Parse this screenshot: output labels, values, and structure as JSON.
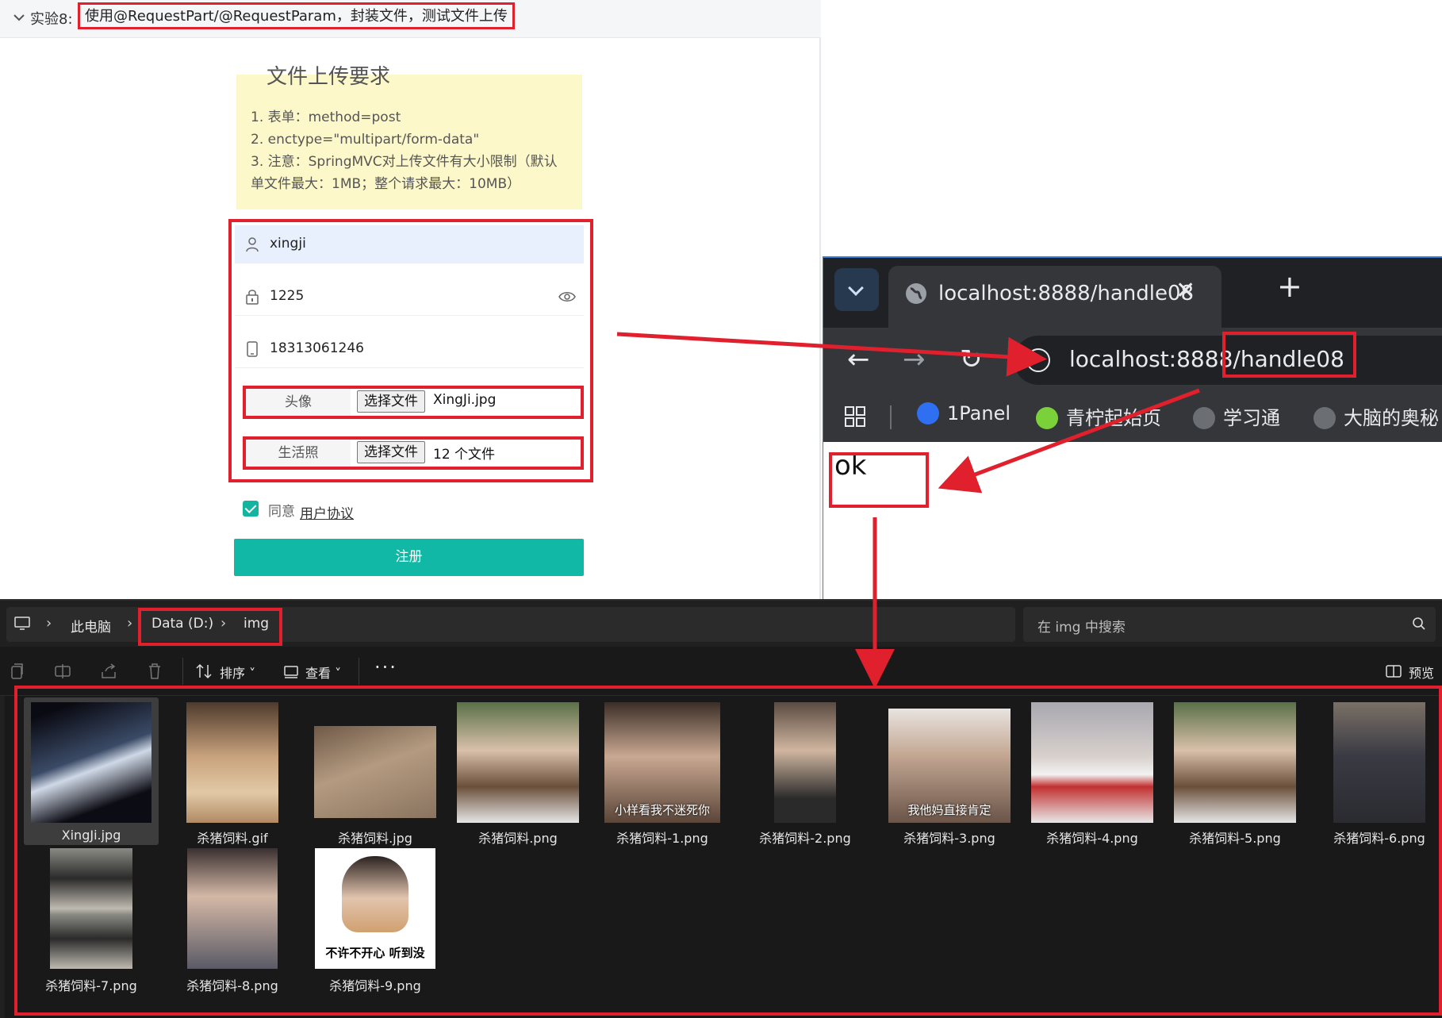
{
  "form": {
    "experiment_label": "实验8:",
    "experiment_title": "使用@RequestPart/@RequestParam，封装文件，测试文件上传",
    "requirements_title": "文件上传要求",
    "requirements": [
      "1. 表单：method=post",
      "2. enctype=\"multipart/form-data\"",
      "3. 注意：SpringMVC对上传文件有大小限制（默认单文件最大：1MB；整个请求最大：10MB）"
    ],
    "username": "xingji",
    "password": "1225",
    "phone": "18313061246",
    "avatar_label": "头像",
    "avatar_button": "选择文件",
    "avatar_file": "XingJi.jpg",
    "photos_label": "生活照",
    "photos_button": "选择文件",
    "photos_file": "12 个文件",
    "agree_text": "同意",
    "agree_link": "用户协议",
    "register_label": "注册"
  },
  "browser": {
    "tab_title": "localhost:8888/handle08",
    "close_glyph": "✕",
    "new_tab_glyph": "+",
    "back_glyph": "←",
    "forward_glyph": "→",
    "reload_glyph": "↻",
    "url_host": "localhost:8888",
    "url_path": "/handle08",
    "bookmarks": [
      "1Panel",
      "青柠起始页",
      "学习通",
      "大脑的奥秘"
    ],
    "page_text": "ok"
  },
  "explorer": {
    "crumb_sep": "›",
    "crumbs": [
      "此电脑",
      "Data (D:)",
      "img"
    ],
    "search_placeholder": "在 img 中搜索",
    "sort_label": "排序",
    "view_label": "查看",
    "more_glyph": "···",
    "preview_label": "预览",
    "files": [
      {
        "name": "XingJi.jpg",
        "overlay": ""
      },
      {
        "name": "杀猪饲料.gif",
        "overlay": ""
      },
      {
        "name": "杀猪饲料.jpg",
        "overlay": ""
      },
      {
        "name": "杀猪饲料.png",
        "overlay": ""
      },
      {
        "name": "杀猪饲料-1.png",
        "overlay": "小样看我不迷死你"
      },
      {
        "name": "杀猪饲料-2.png",
        "overlay": ""
      },
      {
        "name": "杀猪饲料-3.png",
        "overlay": "我他妈直接肯定"
      },
      {
        "name": "杀猪饲料-4.png",
        "overlay": ""
      },
      {
        "name": "杀猪饲料-5.png",
        "overlay": ""
      },
      {
        "name": "杀猪饲料-6.png",
        "overlay": ""
      },
      {
        "name": "杀猪饲料-7.png",
        "overlay": ""
      },
      {
        "name": "杀猪饲料-8.png",
        "overlay": ""
      },
      {
        "name": "杀猪饲料-9.png",
        "overlay": "不许不开心 听到没"
      }
    ]
  },
  "colors": {
    "accent_teal": "#12b8a6",
    "highlight_red": "#e0202c",
    "note_yellow": "#fdf8c9"
  }
}
